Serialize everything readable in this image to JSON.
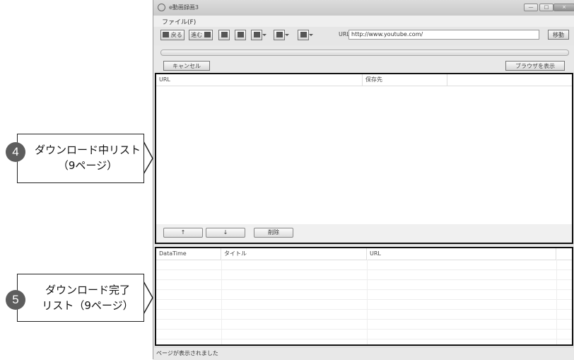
{
  "window": {
    "title": "e動画録画3",
    "minimize": "—",
    "maximize": "□",
    "close": "×"
  },
  "menu": {
    "file": "ファイル(F)"
  },
  "toolbar": {
    "back_label": "戻る",
    "forward_label": "進む",
    "url_label": "URL:",
    "url_value": "http://www.youtube.com/",
    "go_label": "移動"
  },
  "actions": {
    "cancel_label": "キャンセル",
    "show_browser_label": "ブラウザを表示"
  },
  "download_list": {
    "columns": [
      "URL",
      "保存先"
    ],
    "up_label": "↑",
    "down_label": "↓",
    "delete_label": "削除"
  },
  "completed_list": {
    "columns": [
      "DataTime",
      "タイトル",
      "URL"
    ]
  },
  "status": {
    "text": "ページが表示されました"
  },
  "callouts": {
    "c4": {
      "number": "4",
      "line1": "ダウンロード中リスト",
      "line2": "（9ページ）"
    },
    "c5": {
      "number": "5",
      "line1": "ダウンロード完了",
      "line2": "リスト（9ページ）"
    }
  }
}
